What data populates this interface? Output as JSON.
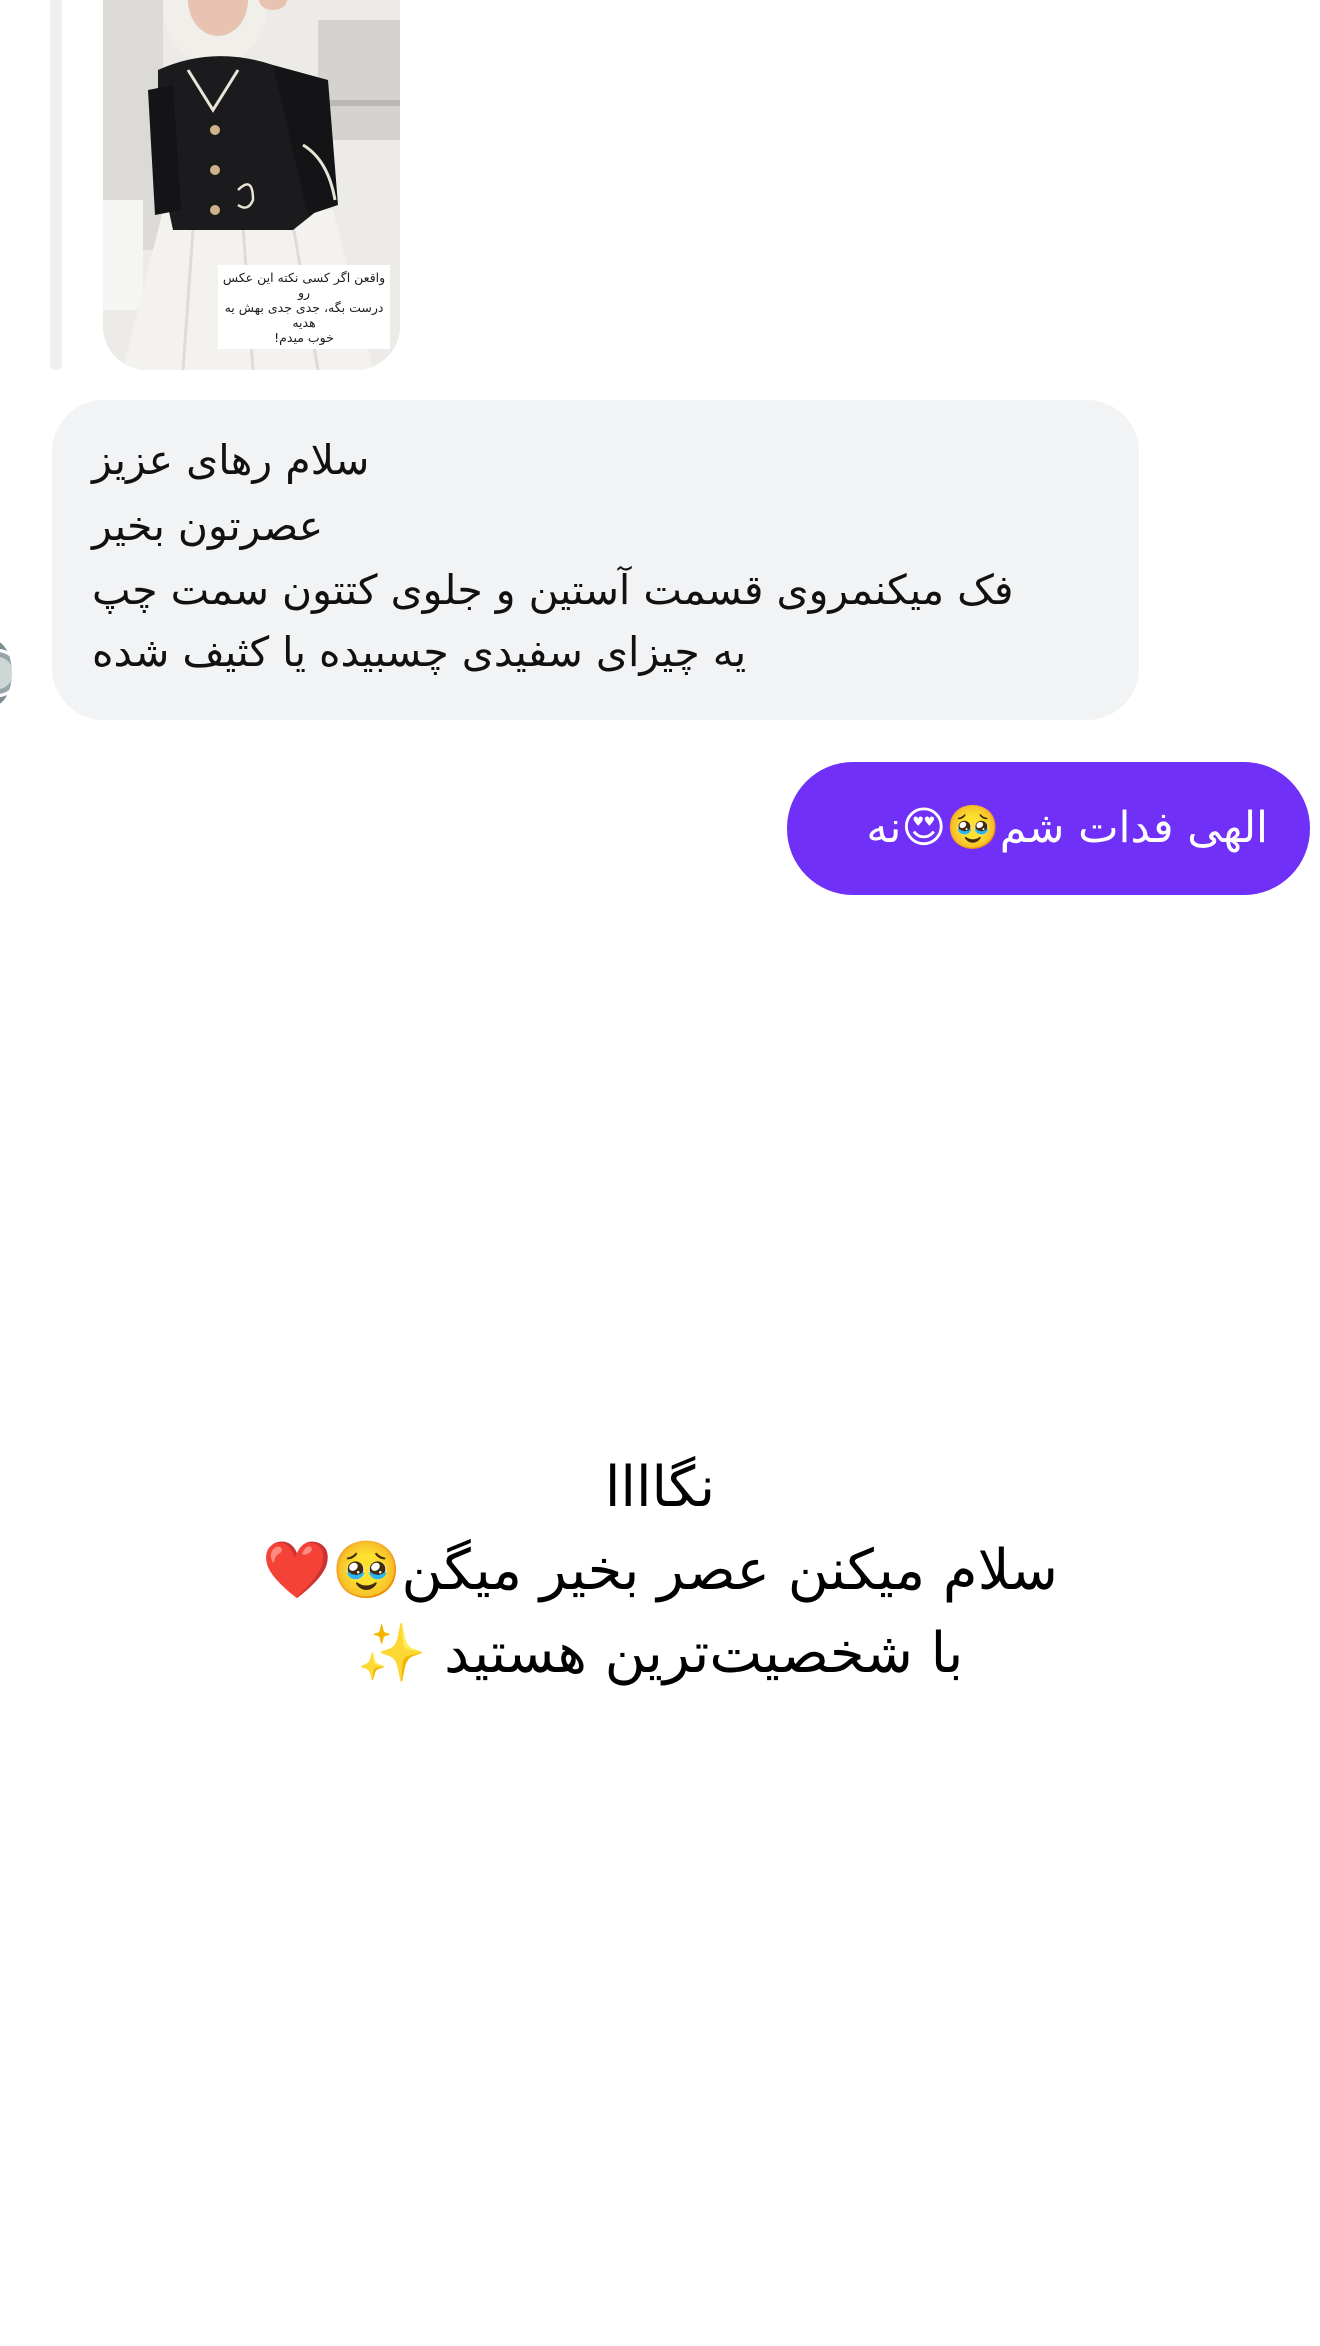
{
  "shared_post": {
    "caption_lines": [
      "واقعن اگر کسی نکته این عکس رو",
      "درست بگه، جدی جدی بهش یه هدیه",
      "خوب میدم!"
    ]
  },
  "messages": {
    "incoming": {
      "lines": [
        "سلام رهای عزیز",
        "عصرتون بخیر",
        "فک میکنمروی قسمت آستین و جلوی کتتون سمت چپ",
        "یه چیزای سفیدی چسبیده یا کثیف شده"
      ]
    },
    "outgoing": {
      "text": "الهی فدات شم🥹😍نه"
    }
  },
  "overlay_caption": {
    "lines": [
      "نگاااا",
      "سلام میکنن عصر بخیر میگن🥹❤️",
      "با شخصیت‌ترین هستید ✨"
    ]
  },
  "colors": {
    "incoming_bubble": "#f2f3f5",
    "outgoing_bubble": "#7030f7",
    "outgoing_text": "#ffffff"
  }
}
